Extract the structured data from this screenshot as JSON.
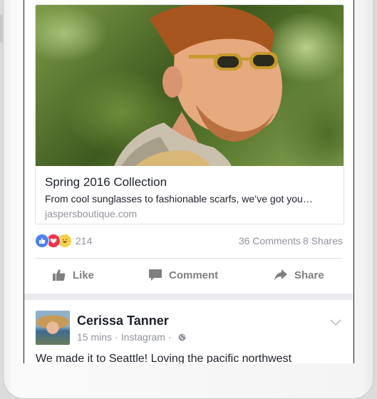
{
  "post": {
    "link_preview": {
      "title": "Spring 2016 Collection",
      "description": "From cool sunglasses to fashionable scarfs, we’ve got you…",
      "domain": "jaspersboutique.com"
    },
    "reactions": {
      "count": "214",
      "comments": "36 Comments",
      "shares": "8 Shares",
      "icons": [
        "like-reaction-icon",
        "love-reaction-icon",
        "haha-reaction-icon"
      ]
    },
    "actions": {
      "like": "Like",
      "comment": "Comment",
      "share": "Share"
    }
  },
  "next_post": {
    "author": "Cerissa Tanner",
    "time": "15 mins",
    "source": "Instagram",
    "separator": "·",
    "text": "We made it to Seattle! Loving the pacific northwest"
  },
  "colors": {
    "brand_blue": "#4e81f1",
    "love_red": "#f0334c",
    "haha_yellow": "#f7cf4a",
    "muted_text": "#90949c",
    "action_gray": "#7f7f7f"
  }
}
